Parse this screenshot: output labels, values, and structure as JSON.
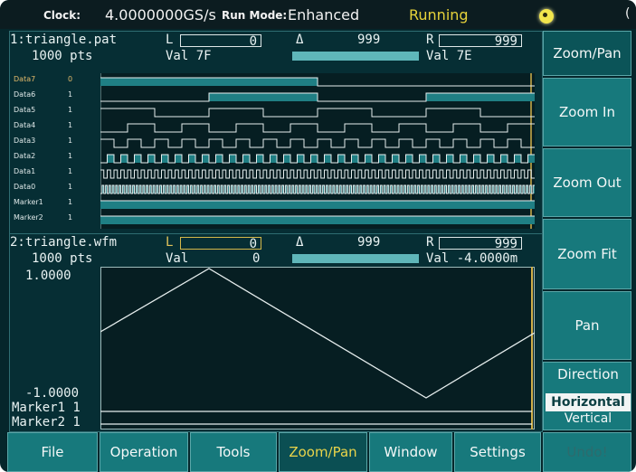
{
  "status": {
    "clock_label": "Clock:",
    "clock_value": "4.0000000GS/s",
    "runmode_label": "Run Mode:",
    "runmode_value": "Enhanced",
    "state": "Running",
    "corner_char": "("
  },
  "panel1": {
    "name": "1:triangle.pat",
    "points": "1000 pts",
    "L_label": "L",
    "L_value": "0",
    "delta_symbol": "Δ",
    "delta_value": "999",
    "R_label": "R",
    "R_value": "999",
    "val_left": "Val  7F",
    "val_right": "Val  7E",
    "channels": [
      {
        "label": "Data7",
        "value": "0",
        "color": "#e1b96a"
      },
      {
        "label": "Data6",
        "value": "1",
        "color": "#dfe8e8"
      },
      {
        "label": "Data5",
        "value": "1",
        "color": "#dfe8e8"
      },
      {
        "label": "Data4",
        "value": "1",
        "color": "#dfe8e8"
      },
      {
        "label": "Data3",
        "value": "1",
        "color": "#dfe8e8"
      },
      {
        "label": "Data2",
        "value": "1",
        "color": "#dfe8e8"
      },
      {
        "label": "Data1",
        "value": "1",
        "color": "#dfe8e8"
      },
      {
        "label": "Data0",
        "value": "1",
        "color": "#dfe8e8"
      },
      {
        "label": "Marker1",
        "value": "1",
        "color": "#dfe8e8"
      },
      {
        "label": "Marker2",
        "value": "1",
        "color": "#dfe8e8"
      }
    ]
  },
  "panel2": {
    "name": "2:triangle.wfm",
    "points": "1000 pts",
    "L_label": "L",
    "L_value": "0",
    "delta_symbol": "Δ",
    "delta_value": "999",
    "R_label": "R",
    "R_value": "999",
    "val_left_label": "Val",
    "val_left_value": "0",
    "val_right": "Val -4.0000m",
    "y_top": "1.0000",
    "y_bottom": "-1.0000",
    "marker1": "Marker1  1",
    "marker2": "Marker2  1"
  },
  "softkeys": {
    "title": "Zoom/Pan",
    "zoom_in": "Zoom In",
    "zoom_out": "Zoom Out",
    "zoom_fit": "Zoom Fit",
    "pan": "Pan",
    "direction": "Direction",
    "direction_selected": "Horizontal",
    "direction_other": "Vertical"
  },
  "menu": {
    "file": "File",
    "operation": "Operation",
    "tools": "Tools",
    "zoompan": "Zoom/Pan",
    "window": "Window",
    "settings": "Settings",
    "undo": "Undo!"
  },
  "colors": {
    "background": "#05262b",
    "button": "#17797c",
    "active_text": "#e9d44a",
    "running": "#e6d23a",
    "trace": "#e6eeee"
  }
}
